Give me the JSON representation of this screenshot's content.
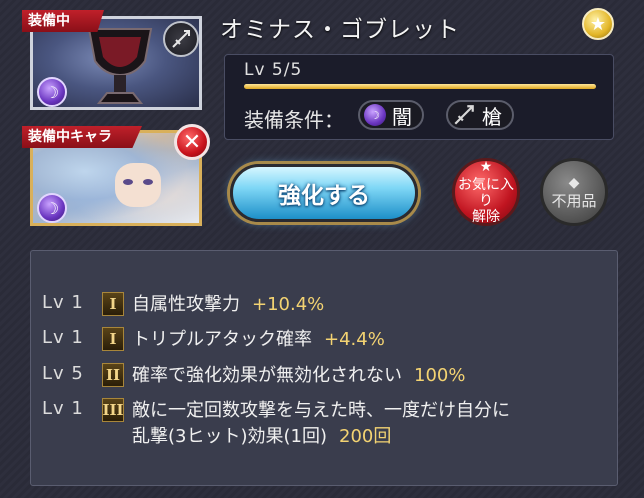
{
  "item": {
    "name": "オミナス・ゴブレット",
    "equipped_tag": "装備中",
    "level_text": "Lv 5/5",
    "level_progress": 1.0,
    "requirements_label": "装備条件：",
    "req_element": "闇",
    "req_weapon": "槍"
  },
  "character": {
    "equipped_chara_tag": "装備中キャラ"
  },
  "buttons": {
    "upgrade": "強化する",
    "unfavorite_line1": "お気に入り",
    "unfavorite_line2": "解除",
    "junk": "不用品"
  },
  "skills": [
    {
      "lv": "Lv 1",
      "rank": "I",
      "name": "自属性攻撃力",
      "value": "+10.4%"
    },
    {
      "lv": "Lv 1",
      "rank": "I",
      "name": "トリプルアタック確率",
      "value": "+4.4%"
    },
    {
      "lv": "Lv 5",
      "rank": "II",
      "name": "確率で強化効果が無効化されない",
      "value": "100%"
    },
    {
      "lv": "Lv 1",
      "rank": "III",
      "name_line1": "敵に一定回数攻撃を与えた時、一度だけ自分に",
      "name_line2": "乱撃(3ヒット)効果(1回)",
      "value": "200回"
    }
  ],
  "colors": {
    "accent_gold": "#f3d372",
    "tag_red": "#c0202a",
    "upgrade_blue": "#1d8fc8"
  },
  "icons": [
    "goblet-image",
    "dark-element-icon",
    "spear-icon",
    "close-icon",
    "star-icon",
    "junk-icon"
  ]
}
